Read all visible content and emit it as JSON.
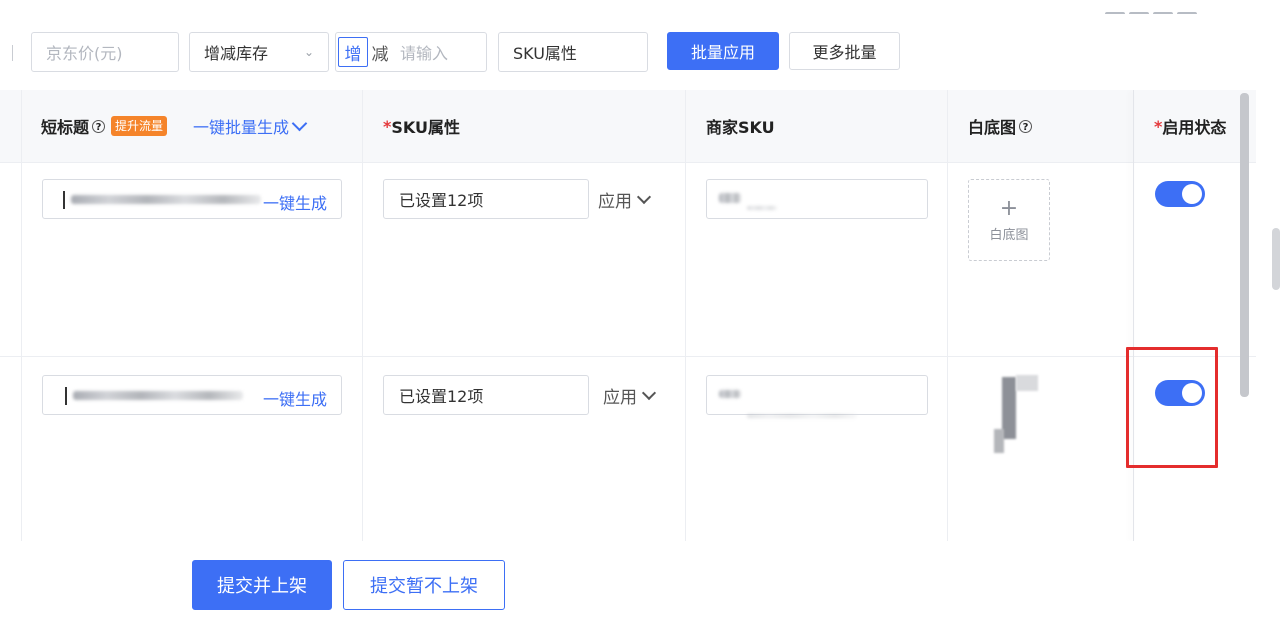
{
  "toolbar": {
    "price_placeholder": "京东价(元)",
    "stock_mode": "增减库存",
    "add_label": "增",
    "sub_label": "减",
    "qty_placeholder": "请输入",
    "sku_attr_value": "SKU属性",
    "batch_apply_label": "批量应用",
    "more_batch_label": "更多批量"
  },
  "table": {
    "headers": {
      "short_title": "短标题",
      "boost_badge": "提升流量",
      "batch_generate": "一键批量生成",
      "sku_attr": "SKU属性",
      "merchant_sku": "商家SKU",
      "white_bg": "白底图",
      "enable_status": "启用状态",
      "required_mark": "*"
    },
    "rows": [
      {
        "generate_label": "一键生成",
        "sku_attr_value": "已设置12项",
        "apply_label": "应用",
        "white_bg_label": "白底图",
        "enabled": true
      },
      {
        "generate_label": "一键生成",
        "sku_attr_value": "已设置12项",
        "apply_label": "应用",
        "enabled": true
      }
    ]
  },
  "footer": {
    "submit_list_label": "提交并上架",
    "submit_unlisted_label": "提交暂不上架"
  },
  "colors": {
    "primary": "#3d6ff5",
    "badge": "#f5842a",
    "required": "#e4393c",
    "highlight": "#e42d2d"
  }
}
